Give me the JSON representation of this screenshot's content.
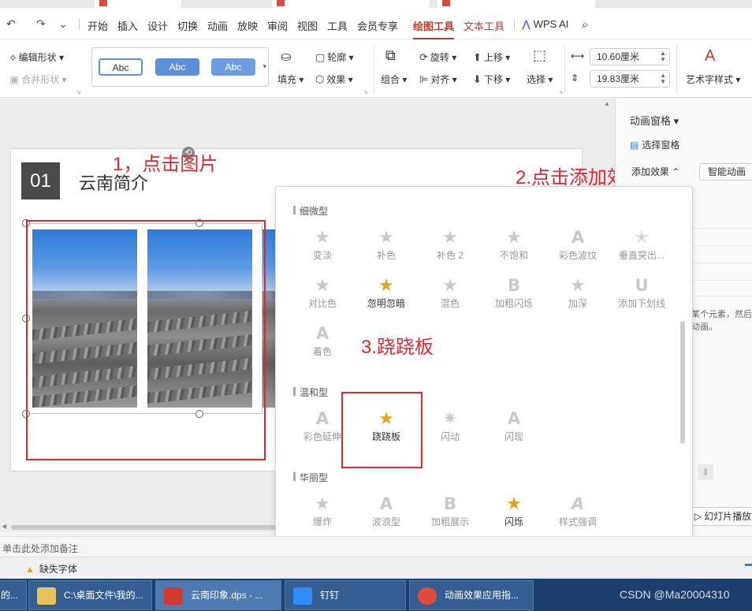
{
  "quick_access": {
    "undo": "↶",
    "redo": "↷",
    "more": "⌄"
  },
  "menu": {
    "items": [
      "开始",
      "插入",
      "设计",
      "切换",
      "动画",
      "放映",
      "审阅",
      "视图",
      "工具",
      "会员专享"
    ],
    "active": "绘图工具",
    "text_tools": "文本工具",
    "wps_ai": "WPS AI"
  },
  "ribbon": {
    "edit_shape": "编辑形状",
    "merge_shape": "合并形状",
    "style_samples": [
      "Abc",
      "Abc",
      "Abc"
    ],
    "fill": "填充",
    "outline": "轮廓",
    "effect": "效果",
    "group": "组合",
    "rotate": "旋转",
    "align": "对齐",
    "up": "上移",
    "down": "下移",
    "select": "选择",
    "width": "10.60厘米",
    "height": "19.83厘米",
    "art_text": "艺术字样式"
  },
  "slide": {
    "number": "01",
    "title": "云南简介"
  },
  "annotations": {
    "step1": "1，点击图片",
    "step2": "2.点击添加效果",
    "step3": "3.跷跷板"
  },
  "anim_panel": {
    "title": "动画窗格",
    "select_pane": "选择窗格",
    "add_effect": "添加效果",
    "smart_anim": "智能动画",
    "hint": "某个元素，然后动画。",
    "slideshow": "幻灯片播放"
  },
  "effects": {
    "subtle": {
      "heading": "细微型",
      "items": [
        "变淡",
        "补色",
        "补色 2",
        "不饱和",
        "彩色波纹",
        "垂直突出...",
        "对比色",
        "忽明忽暗",
        "混色",
        "加粗闪烁",
        "加深",
        "添加下划线",
        "着色"
      ]
    },
    "moderate": {
      "heading": "温和型",
      "items": [
        "彩色延伸",
        "跷跷板",
        "闪动",
        "闪现"
      ]
    },
    "exciting": {
      "heading": "华丽型",
      "items": [
        "爆炸",
        "波浪型",
        "加粗展示",
        "闪烁",
        "样式强调"
      ]
    }
  },
  "notes_placeholder": "单击此处添加备注",
  "status": {
    "missing_font": "缺失字体"
  },
  "taskbar": {
    "items": [
      "的...",
      "C:\\桌面文件\\我的...",
      "云南印象.dps - ...",
      "钉钉",
      "动画效果应用指..."
    ],
    "watermark": "CSDN @Ma20004310"
  },
  "colors": {
    "accent_red": "#e0282e",
    "wps_red": "#c0392b",
    "style_blue": "#5b8fd9",
    "star_gold": "#e6a11f"
  }
}
